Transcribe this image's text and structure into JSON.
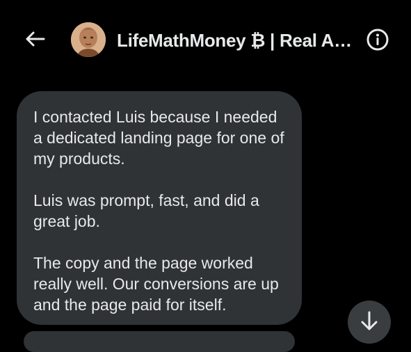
{
  "header": {
    "title": "LifeMathMoney ₿ | Real Adv..."
  },
  "message": {
    "paragraphs": [
      "I contacted Luis because I needed a dedicated landing page for one of my products.",
      "Luis was prompt, fast, and did a great job.",
      "The copy and the page worked really well. Our conversions are up and the page paid for itself."
    ]
  },
  "icons": {
    "back": "arrow-left-icon",
    "info": "info-icon",
    "scroll": "arrow-down-icon"
  },
  "colors": {
    "background": "#000000",
    "bubble": "#2f3336",
    "text": "#e7e9ea",
    "scroll_button": "#3a3d40"
  }
}
